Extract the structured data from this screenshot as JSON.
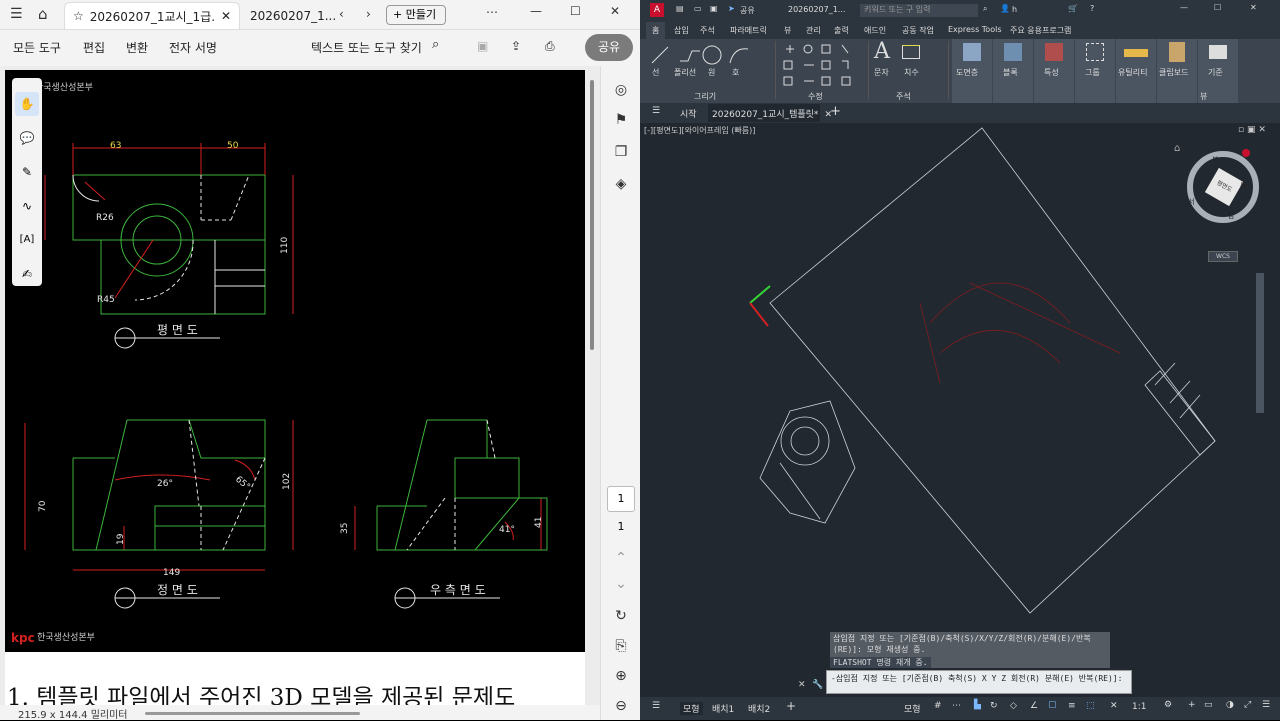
{
  "left": {
    "tabs": [
      {
        "label": "20260207_1교시_1급..."
      },
      {
        "label": "20260207_1..."
      }
    ],
    "new_label": "만들기",
    "menu": [
      "모든 도구",
      "편집",
      "변환",
      "전자 서명"
    ],
    "search_label": "텍스트 또는 도구 찾기",
    "share_label": "공유",
    "page_current": "1",
    "page_total": "1",
    "page_size": "215.9 x 144.4 밀리미터",
    "body_text": "1. 템플릿 파일에서 주어진 3D 모델을 제공된 문제도",
    "drawing": {
      "corp_top": "한국생산성본부",
      "corp_bottom": "한국생산성본부",
      "logo": "kpc",
      "view_plan": "평 면 도",
      "view_front": "정 면 도",
      "view_side": "우 측 면 도",
      "dims": {
        "d63": "63",
        "d50": "50",
        "r26": "R26",
        "r45": "R45",
        "d110": "110",
        "d26deg": "26°",
        "d65deg": "65°",
        "d70": "70",
        "d102": "102",
        "d19": "19",
        "d149": "149",
        "d35": "35",
        "d41": "41",
        "d41deg": "41°",
        "d36": "36"
      }
    }
  },
  "right": {
    "share": "공유",
    "doc_title": "20260207_1...",
    "search_placeholder": "키워드 또는 구 입력",
    "user": "h",
    "tabs": [
      "홈",
      "삽입",
      "주석",
      "파라메트릭",
      "뷰",
      "관리",
      "출력",
      "애드인",
      "공동 작업",
      "Express Tools",
      "주요 응용프로그램"
    ],
    "ribbon": {
      "draw": [
        "선",
        "폴리선",
        "원",
        "호"
      ],
      "draw_group": "그리기",
      "modify_group": "수정",
      "annot": [
        "문자",
        "치수"
      ],
      "annot_group": "주석",
      "big": [
        "도면층",
        "블록",
        "특성",
        "그룹",
        "유틸리티",
        "클립보드",
        "기준"
      ],
      "view_group": "뷰"
    },
    "doc_tabs": [
      "시작",
      "20260207_1교시_템플릿*"
    ],
    "viewport_label": "[-][평면도][와이어프레임 (빠름)]",
    "cube": {
      "top": "평면도",
      "n": "북",
      "s": "남",
      "e": "동",
      "w": "서",
      "wcs": "WCS"
    },
    "cmd_lines": [
      "삽입점 지정 또는 [기준점(B)/축척(S)/X/Y/Z/회전(R)/분해(E)/반복",
      "(RE)]: 모형 재생성 중.",
      "FLATSHOT 명령 재개 중."
    ],
    "cmd_prompt": "-삽입점 지정 또는 [기준점(B) 축척(S) X Y Z 회전(R) 분해(E) 반복(RE)]:",
    "status_tabs": [
      "모형",
      "배치1",
      "배치2"
    ],
    "status_model": "모형",
    "scale": "1:1"
  }
}
